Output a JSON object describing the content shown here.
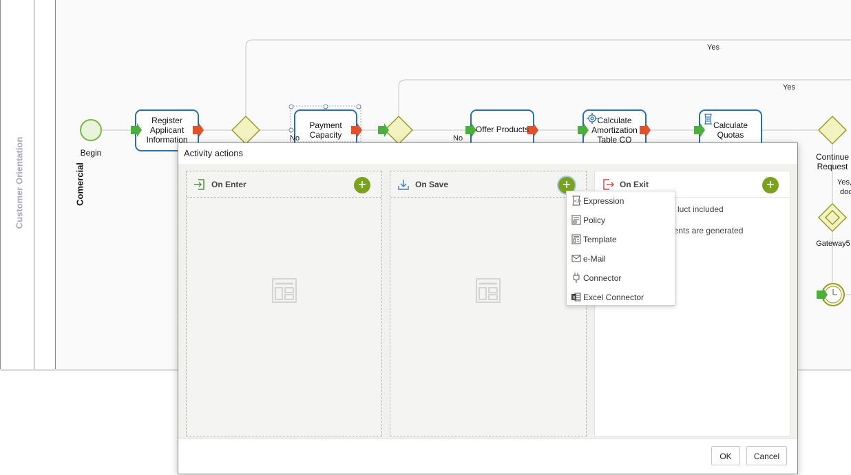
{
  "lanes": {
    "pool_label": "Customer Orientation",
    "lane_label": "Comercial"
  },
  "diagram": {
    "start_event_label": "Begin",
    "tasks": [
      {
        "id": "register",
        "label_lines": [
          "Register",
          "Applicant",
          "Information"
        ]
      },
      {
        "id": "payment",
        "label_lines": [
          "Payment",
          "Capacity"
        ]
      },
      {
        "id": "offer",
        "label_lines": [
          "Offer Products"
        ]
      },
      {
        "id": "amortization",
        "label_lines": [
          "Calculate",
          "Amortization",
          "Table CO"
        ]
      },
      {
        "id": "quotas",
        "label_lines": [
          "Calculate",
          "Quotas"
        ]
      }
    ],
    "gateway_continue_lines": [
      "Continue",
      "Request"
    ],
    "gateway5_label": "Gateway5",
    "flow_labels": {
      "yes_top": "Yes",
      "yes_mid": "Yes",
      "no_1": "No",
      "no_2": "No",
      "yes_right": "Yes,",
      "yes_right_2": "doc"
    }
  },
  "dialog": {
    "title": "Activity actions",
    "panels": {
      "on_enter": {
        "title": "On Enter"
      },
      "on_save": {
        "title": "On Save"
      },
      "on_exit": {
        "title": "On Exit",
        "items": [
          "luct included",
          "nents are generated"
        ]
      }
    },
    "ok_label": "OK",
    "cancel_label": "Cancel"
  },
  "add_menu": {
    "items": [
      {
        "label": "Expression",
        "icon": "expression-icon"
      },
      {
        "label": "Policy",
        "icon": "policy-icon"
      },
      {
        "label": "Template",
        "icon": "template-icon"
      },
      {
        "label": "e-Mail",
        "icon": "email-icon"
      },
      {
        "label": "Connector",
        "icon": "connector-icon"
      },
      {
        "label": "Excel Connector",
        "icon": "excel-icon"
      }
    ]
  },
  "colors": {
    "add_button": "#7ba21f",
    "task_border": "#2a6fa8",
    "gateway_fill": "#f3f3c2",
    "gateway_stroke": "#9a9a2a",
    "start_event": "#7ab648",
    "marker_in": "#4cae3c",
    "marker_out": "#e0532a"
  }
}
